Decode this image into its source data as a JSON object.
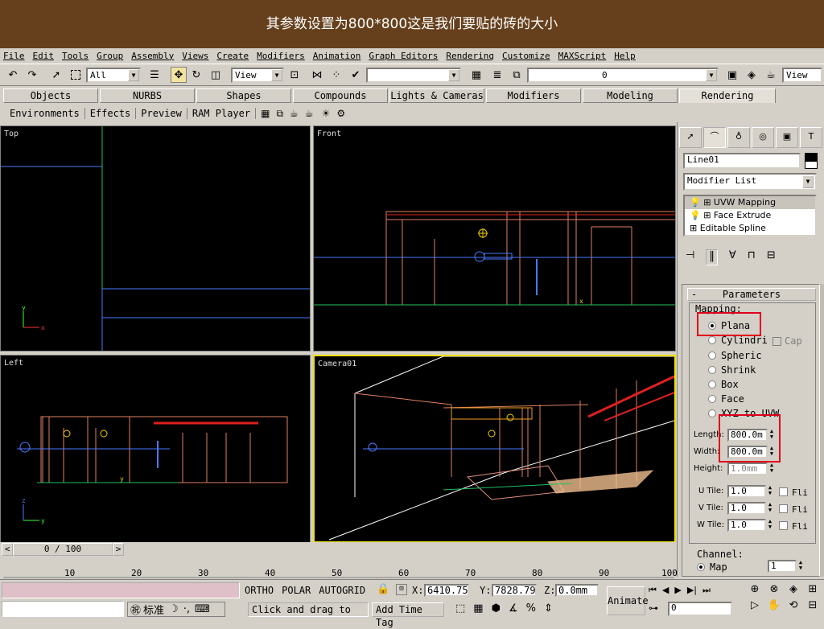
{
  "banner": {
    "text": "其参数设置为800*800这是我们要贴的砖的大小"
  },
  "menu": [
    "File",
    "Edit",
    "Tools",
    "Group",
    "Assembly",
    "Views",
    "Create",
    "Modifiers",
    "Animation",
    "Graph Editors",
    "Rendering",
    "Customize",
    "MAXScript",
    "Help"
  ],
  "toolbar": {
    "selection_filter": "All",
    "ref_coord": "View",
    "named_selection": "",
    "layer": "0",
    "right_view": "View"
  },
  "tabs": [
    "Objects",
    "NURBS",
    "Shapes",
    "Compounds",
    "Lights & Cameras",
    "Modifiers",
    "Modeling",
    "Rendering"
  ],
  "active_tab": "Rendering",
  "subtools": [
    "Environments",
    "Effects",
    "Preview",
    "RAM Player"
  ],
  "viewports": {
    "top": "Top",
    "front": "Front",
    "left": "Left",
    "camera": "Camera01"
  },
  "panel": {
    "object_name": "Line01",
    "modifier_list": "Modifier List",
    "stack": [
      "UVW Mapping",
      "Face Extrude",
      "Editable Spline"
    ],
    "rollout_title": "Parameters",
    "mapping_label": "Mapping:",
    "mapping_options": [
      "Plana",
      "Cylindri",
      "Spheric",
      "Shrink",
      "Box",
      "Face",
      "XYZ to UVW"
    ],
    "cap_label": "Cap",
    "length_label": "Length:",
    "length_value": "800.0m",
    "width_label": "Width:",
    "width_value": "800.0m",
    "height_label": "Height:",
    "height_value": "1.0mm",
    "utile_label": "U Tile:",
    "utile_value": "1.0",
    "vtile_label": "V Tile:",
    "vtile_value": "1.0",
    "wtile_label": "W Tile:",
    "wtile_value": "1.0",
    "flip_label": "Fli",
    "channel_label": "Channel:",
    "map_label": "Map",
    "channel_value": "1"
  },
  "timeline": {
    "counter": "0 / 100",
    "ticks": [
      "10",
      "20",
      "30",
      "40",
      "50",
      "60",
      "70",
      "80",
      "90",
      "100"
    ]
  },
  "status": {
    "ortho": "ORTHO",
    "polar": "POLAR",
    "autogrid": "AUTOGRID",
    "x_label": "X:",
    "x_value": "6410.75",
    "y_label": "Y:",
    "y_value": "7828.79",
    "z_label": "Z:",
    "z_value": "0.0mm",
    "prompt": "Click and drag to sel",
    "add_time_tag": "Add Time Tag",
    "animate": "Animate",
    "frame_value": "0",
    "ime_text": "标准"
  },
  "colors": {
    "banner": "#66401c",
    "highlight": "#e0001b",
    "viewport_bg": "#000000",
    "active_vp": "#f0e000"
  }
}
